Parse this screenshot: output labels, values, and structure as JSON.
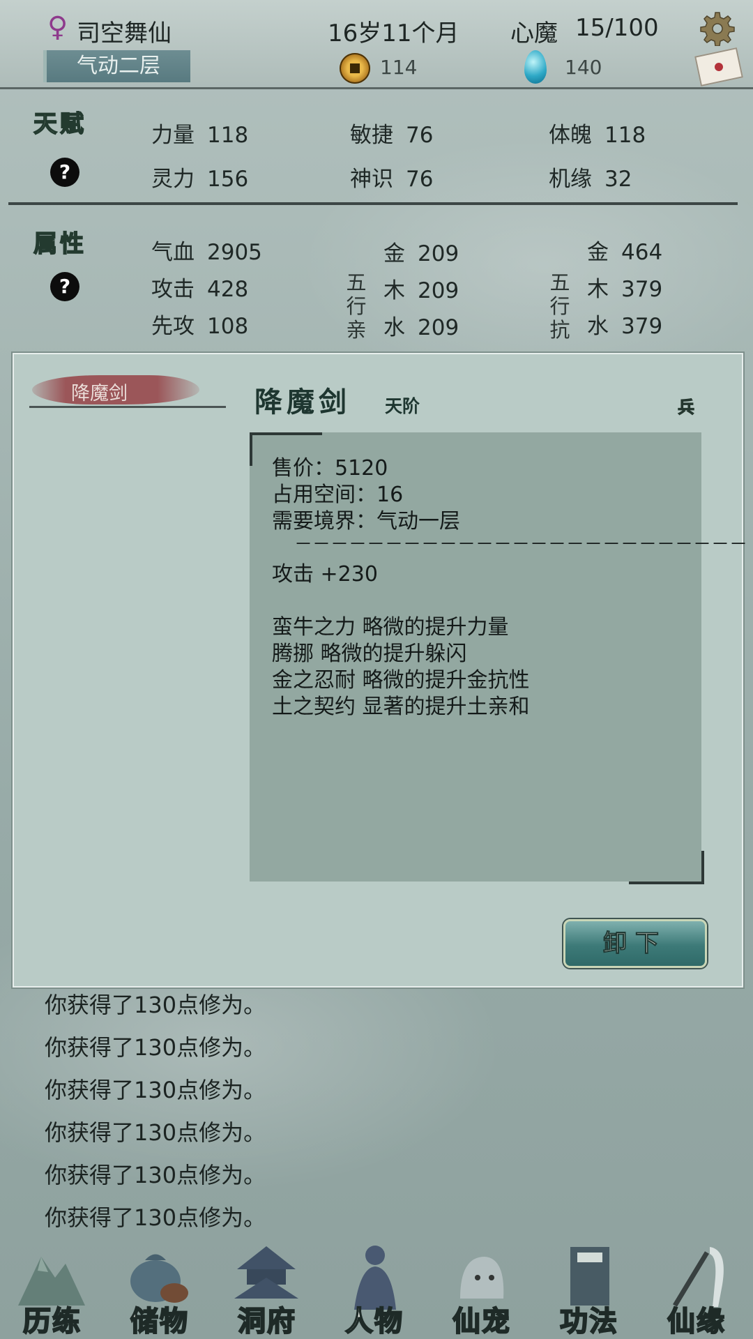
{
  "header": {
    "gender_symbol": "♀",
    "name": "司空舞仙",
    "age": "16岁11个月",
    "heart_demon_label": "心魔",
    "heart_demon_value": "15/100",
    "realm": "气动二层",
    "coins": "114",
    "spirit_stones": "140"
  },
  "talent": {
    "title": "天赋",
    "help": "?",
    "stats": [
      {
        "label": "力量",
        "value": "118"
      },
      {
        "label": "敏捷",
        "value": "76"
      },
      {
        "label": "体魄",
        "value": "118"
      },
      {
        "label": "灵力",
        "value": "156"
      },
      {
        "label": "神识",
        "value": "76"
      },
      {
        "label": "机缘",
        "value": "32"
      }
    ]
  },
  "attributes": {
    "title": "属性",
    "help": "?",
    "basic": [
      {
        "label": "气血",
        "value": "2905"
      },
      {
        "label": "攻击",
        "value": "428"
      },
      {
        "label": "先攻",
        "value": "108"
      }
    ],
    "affinity_label": [
      "五",
      "行",
      "亲"
    ],
    "affinity": [
      {
        "label": "金",
        "value": "209"
      },
      {
        "label": "木",
        "value": "209"
      },
      {
        "label": "水",
        "value": "209"
      }
    ],
    "resist_label": [
      "五",
      "行",
      "抗"
    ],
    "resist": [
      {
        "label": "金",
        "value": "464"
      },
      {
        "label": "木",
        "value": "379"
      },
      {
        "label": "水",
        "value": "379"
      }
    ]
  },
  "modal": {
    "tab_label": "降魔剑",
    "item_name": "降魔剑",
    "item_grade": "天阶",
    "item_type": "兵",
    "description": [
      "售价：5120",
      "占用空间：16",
      "需要境界：气动一层",
      "－－－－－－－－－－－－－－－－－－－－－－－－－",
      "攻击 +230",
      "",
      "蛮牛之力 略微的提升力量",
      "腾挪 略微的提升躲闪",
      "金之忍耐 略微的提升金抗性",
      "土之契约 显著的提升土亲和"
    ],
    "unequip_label": "卸下"
  },
  "log": [
    "你获得了130点修为。",
    "你获得了130点修为。",
    "你获得了130点修为。",
    "你获得了130点修为。",
    "你获得了130点修为。",
    "你获得了130点修为。"
  ],
  "nav": [
    {
      "label": "历练",
      "icon": "mountain-icon"
    },
    {
      "label": "储物",
      "icon": "bag-icon"
    },
    {
      "label": "洞府",
      "icon": "pavilion-icon"
    },
    {
      "label": "人物",
      "icon": "character-icon"
    },
    {
      "label": "仙宠",
      "icon": "pet-icon"
    },
    {
      "label": "功法",
      "icon": "book-icon"
    },
    {
      "label": "仙缘",
      "icon": "crane-icon"
    }
  ],
  "colors": {
    "modal_bg": "#b9cbc6",
    "desc_bg": "#93a8a1",
    "button": "#3d7a78",
    "tab_brush": "#9b5659"
  }
}
